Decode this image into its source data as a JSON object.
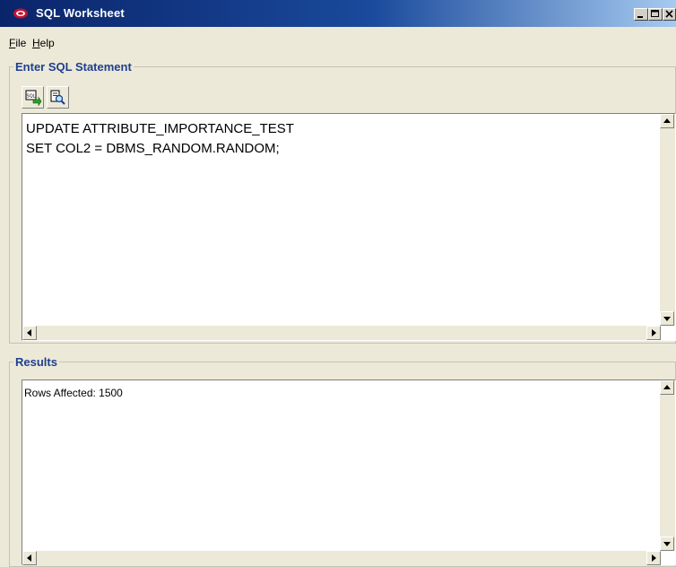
{
  "window": {
    "title": "SQL Worksheet",
    "icon": "oracle-logo-icon",
    "controls": [
      "minimize-icon",
      "maximize-icon",
      "close-icon"
    ]
  },
  "menu": {
    "file": {
      "accel": "F",
      "rest": "ile"
    },
    "help": {
      "accel": "H",
      "rest": "elp"
    }
  },
  "sql_group": {
    "legend": "Enter SQL Statement",
    "toolbar": [
      "execute-sql-icon",
      "explain-plan-icon"
    ],
    "sql_text": "UPDATE ATTRIBUTE_IMPORTANCE_TEST\nSET COL2 = DBMS_RANDOM.RANDOM;"
  },
  "results_group": {
    "legend": "Results",
    "text": "Rows Affected: 1500"
  }
}
